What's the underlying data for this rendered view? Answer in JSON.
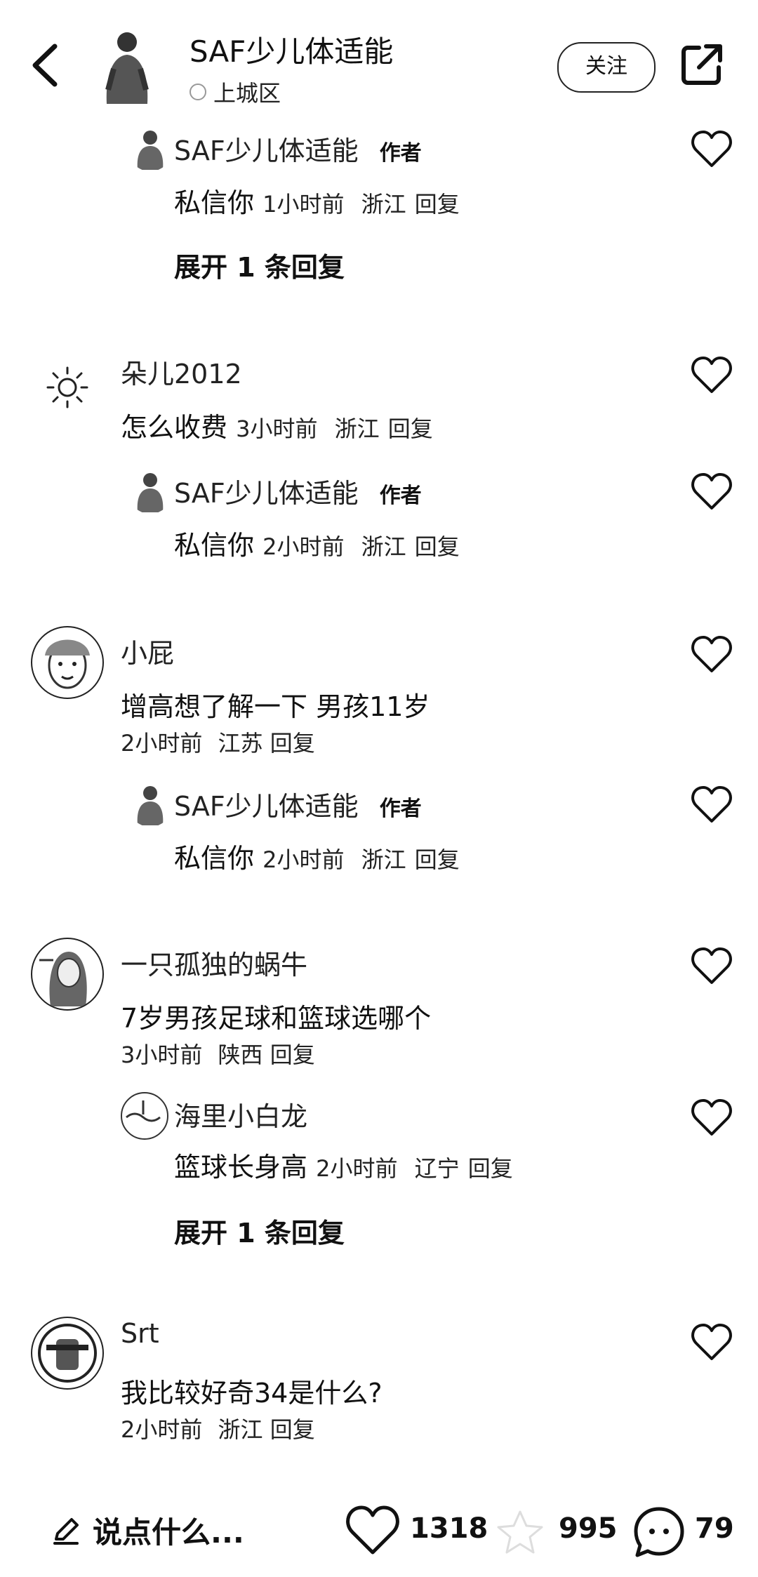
{
  "header": {
    "title": "SAF少儿体适能",
    "location": "上城区",
    "follow_label": "关注"
  },
  "comments": [
    {
      "reply": {
        "name": "SAF少儿体适能",
        "badge": "作者",
        "text": "私信你",
        "time": "1小时前",
        "region": "浙江",
        "reply_label": "回复"
      },
      "expand_label": "展开 1 条回复"
    },
    {
      "name": "朵儿2012",
      "text": "怎么收费",
      "time": "3小时前",
      "region": "浙江",
      "reply_label": "回复",
      "reply": {
        "name": "SAF少儿体适能",
        "badge": "作者",
        "text": "私信你",
        "time": "2小时前",
        "region": "浙江",
        "reply_label": "回复"
      }
    },
    {
      "name": "小屁",
      "text": "增高想了解一下 男孩11岁",
      "time": "2小时前",
      "region": "江苏",
      "reply_label": "回复",
      "reply": {
        "name": "SAF少儿体适能",
        "badge": "作者",
        "text": "私信你",
        "time": "2小时前",
        "region": "浙江",
        "reply_label": "回复"
      }
    },
    {
      "name": "一只孤独的蜗牛",
      "text": "7岁男孩足球和篮球选哪个",
      "time": "3小时前",
      "region": "陕西",
      "reply_label": "回复",
      "reply": {
        "name": "海里小白龙",
        "text": "篮球长身高",
        "time": "2小时前",
        "region": "辽宁",
        "reply_label": "回复"
      },
      "expand_label": "展开 1 条回复"
    },
    {
      "name": "Srt",
      "text": "我比较好奇34是什么?",
      "time": "2小时前",
      "region": "浙江",
      "reply_label": "回复"
    }
  ],
  "bottom_bar": {
    "input_placeholder": "说点什么...",
    "likes": "1318",
    "collects": "995",
    "comments": "79"
  },
  "icons": [
    "back-arrow-icon",
    "share-icon",
    "heart-icon",
    "location-icon",
    "pencil-icon",
    "star-icon",
    "comment-icon",
    "sun-icon"
  ]
}
